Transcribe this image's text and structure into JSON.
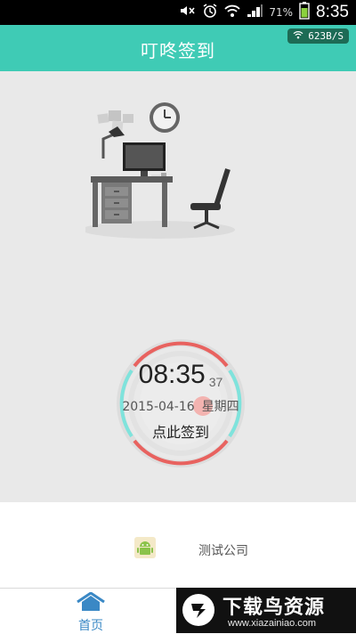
{
  "status_bar": {
    "battery_percent": "71%",
    "time": "8:35",
    "icons": [
      "mute-icon",
      "alarm-icon",
      "wifi-icon",
      "signal-icon",
      "battery-icon"
    ]
  },
  "header": {
    "title": "叮咚签到",
    "network_speed": "623B/S"
  },
  "checkin": {
    "time": "08:35",
    "seconds": "37",
    "date": "2015-04-16",
    "weekday": "星期四",
    "action_label": "点此签到"
  },
  "company": {
    "name": "测试公司"
  },
  "tab_bar": {
    "home_label": "首页"
  },
  "watermark": {
    "title": "下载鸟资源",
    "url": "www.xiazainiao.com"
  },
  "colors": {
    "accent": "#3fcbb5",
    "ring_red": "#e8625f",
    "ring_cyan": "#7fe3dc",
    "tab_blue": "#3a88c5"
  }
}
